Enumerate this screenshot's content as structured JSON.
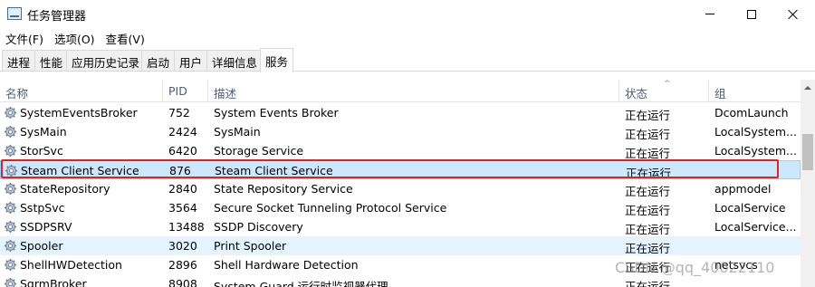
{
  "window": {
    "title": "任务管理器"
  },
  "menu": [
    "文件(F)",
    "选项(O)",
    "查看(V)"
  ],
  "tabs": [
    "进程",
    "性能",
    "应用历史记录",
    "启动",
    "用户",
    "详细信息",
    "服务"
  ],
  "active_tab": "服务",
  "columns": {
    "name": "名称",
    "pid": "PID",
    "description": "描述",
    "status": "状态",
    "group": "组"
  },
  "rows": [
    {
      "name": "SystemEventsBroker",
      "pid": "752",
      "description": "System Events Broker",
      "status": "正在运行",
      "group": "DcomLaunch"
    },
    {
      "name": "SysMain",
      "pid": "2424",
      "description": "SysMain",
      "status": "正在运行",
      "group": "LocalSystem..."
    },
    {
      "name": "StorSvc",
      "pid": "6420",
      "description": "Storage Service",
      "status": "正在运行",
      "group": "LocalSystem..."
    },
    {
      "name": "Steam Client Service",
      "pid": "876",
      "description": "Steam Client Service",
      "status": "正在运行",
      "group": ""
    },
    {
      "name": "StateRepository",
      "pid": "2840",
      "description": "State Repository Service",
      "status": "正在运行",
      "group": "appmodel"
    },
    {
      "name": "SstpSvc",
      "pid": "3564",
      "description": "Secure Socket Tunneling Protocol Service",
      "status": "正在运行",
      "group": "LocalService"
    },
    {
      "name": "SSDPSRV",
      "pid": "13488",
      "description": "SSDP Discovery",
      "status": "正在运行",
      "group": "LocalService..."
    },
    {
      "name": "Spooler",
      "pid": "3020",
      "description": "Print Spooler",
      "status": "正在运行",
      "group": ""
    },
    {
      "name": "ShellHWDetection",
      "pid": "2896",
      "description": "Shell Hardware Detection",
      "status": "正在运行",
      "group": "netsvcs"
    },
    {
      "name": "SgrmBroker",
      "pid": "8908",
      "description": "System Guard 运行时监视器代理",
      "status": "正在运行",
      "group": ""
    }
  ],
  "selected_row": "Steam Client Service",
  "watermark": "CSDN @qq_40022110",
  "colors": {
    "selected_bg": "#cce8ff",
    "hover_bg": "#e5f3ff",
    "highlight_border": "#e2231a",
    "header_text": "#4c607a"
  }
}
